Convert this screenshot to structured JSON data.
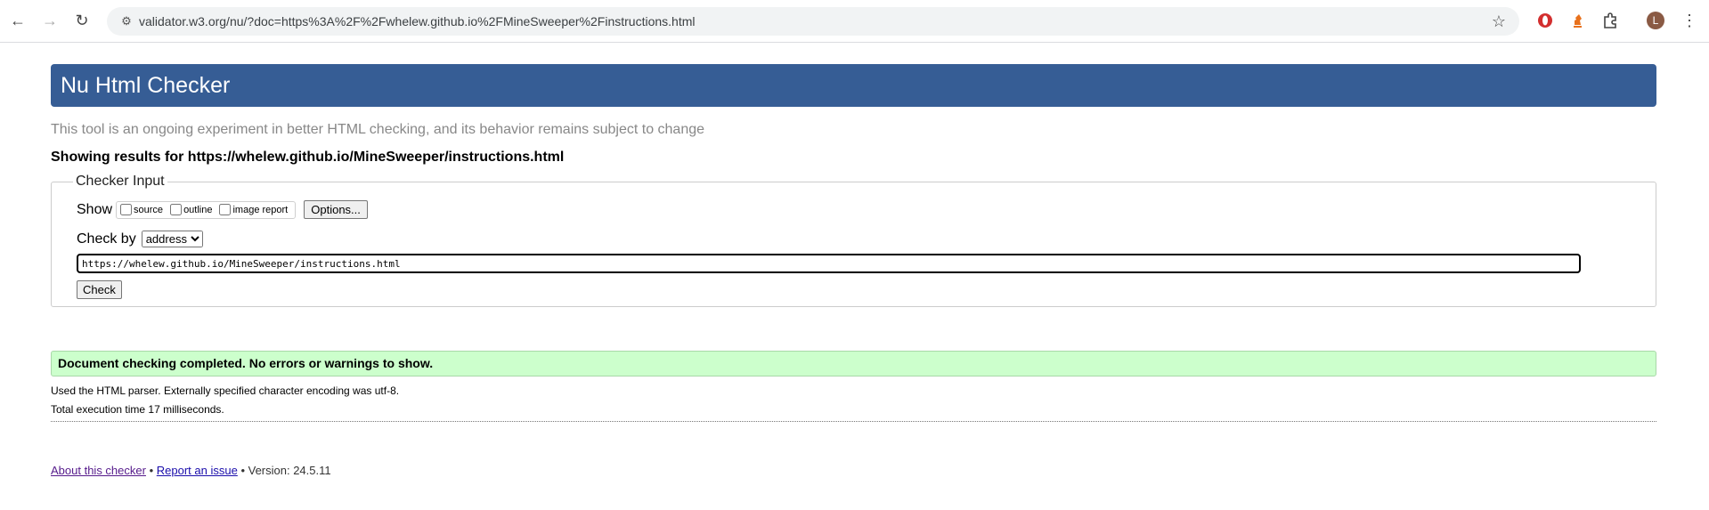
{
  "browser": {
    "url": "validator.w3.org/nu/?doc=https%3A%2F%2Fwhelew.github.io%2FMineSweeper%2Finstructions.html",
    "avatar_letter": "L"
  },
  "page": {
    "title": "Nu Html Checker",
    "intro": "This tool is an ongoing experiment in better HTML checking, and its behavior remains subject to change",
    "showing": "Showing results for https://whelew.github.io/MineSweeper/instructions.html",
    "checker": {
      "legend": "Checker Input",
      "show_label": "Show",
      "options": [
        "source",
        "outline",
        "image report"
      ],
      "options_button": "Options...",
      "check_by_label": "Check by",
      "check_by_value": "address",
      "input_value": "https://whelew.github.io/MineSweeper/instructions.html",
      "check_button": "Check"
    },
    "result": "Document checking completed. No errors or warnings to show.",
    "details": [
      "Used the HTML parser. Externally specified character encoding was utf-8.",
      "Total execution time 17 milliseconds."
    ],
    "footer": {
      "about": "About this checker",
      "separator": "•",
      "report": "Report an issue",
      "version": "• Version: 24.5.11"
    }
  },
  "colors": {
    "header": "#365d95",
    "success_bg": "#ccffcc"
  }
}
